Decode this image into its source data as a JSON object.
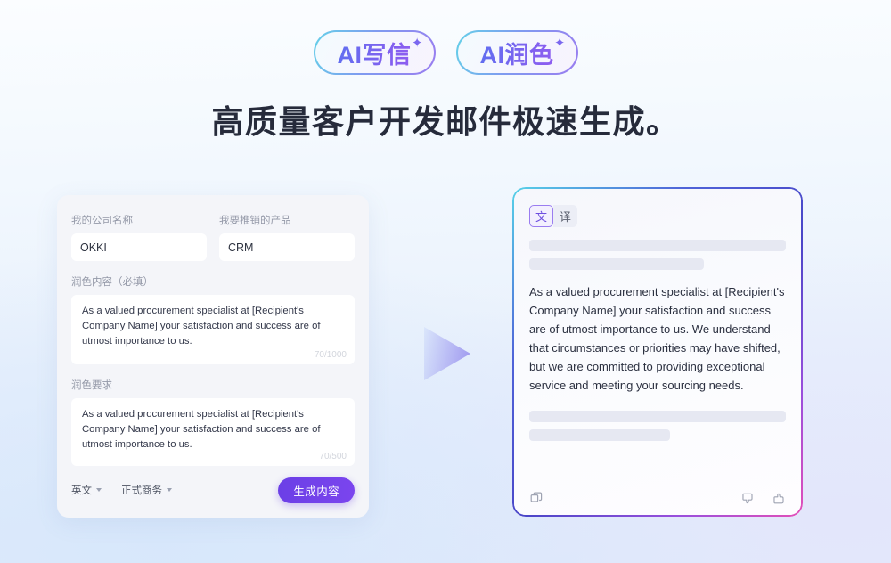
{
  "header": {
    "badges": [
      {
        "label": "AI写信",
        "sparkle": "✦"
      },
      {
        "label": "AI润色",
        "sparkle": "✦"
      }
    ],
    "headline": "高质量客户开发邮件极速生成。"
  },
  "form": {
    "company": {
      "label": "我的公司名称",
      "value": "OKKI",
      "placeholder": "我的公司名称"
    },
    "product": {
      "label": "我要推销的产品",
      "value": "CRM",
      "placeholder": "我要推销的产品"
    },
    "content": {
      "label": "润色内容（必填）",
      "value": "As a valued procurement specialist at [Recipient's Company Name] your satisfaction and success are of utmost importance to us.",
      "counter": "70/1000"
    },
    "requirement": {
      "label": "润色要求",
      "value": "As a valued procurement specialist at [Recipient's Company Name] your satisfaction and success are of utmost importance to us.",
      "counter": "70/500"
    },
    "language_select": "英文",
    "tone_select": "正式商务",
    "generate_button": "生成内容"
  },
  "result": {
    "toggle": {
      "original": "文",
      "translate": "译"
    },
    "body": "As a valued procurement specialist at [Recipient's Company Name] your satisfaction and success are of utmost importance to us. We understand that circumstances or priorities may have shifted, but we are committed to providing exceptional service and meeting your sourcing needs.",
    "actions": {
      "copy": "copy-icon",
      "dislike": "thumbs-down-icon",
      "like": "thumbs-up-icon"
    }
  },
  "colors": {
    "accent_purple": "#6b3fe6",
    "gradient_start": "#57d2e8",
    "gradient_end": "#e34fb8",
    "headline": "#262b3b"
  }
}
